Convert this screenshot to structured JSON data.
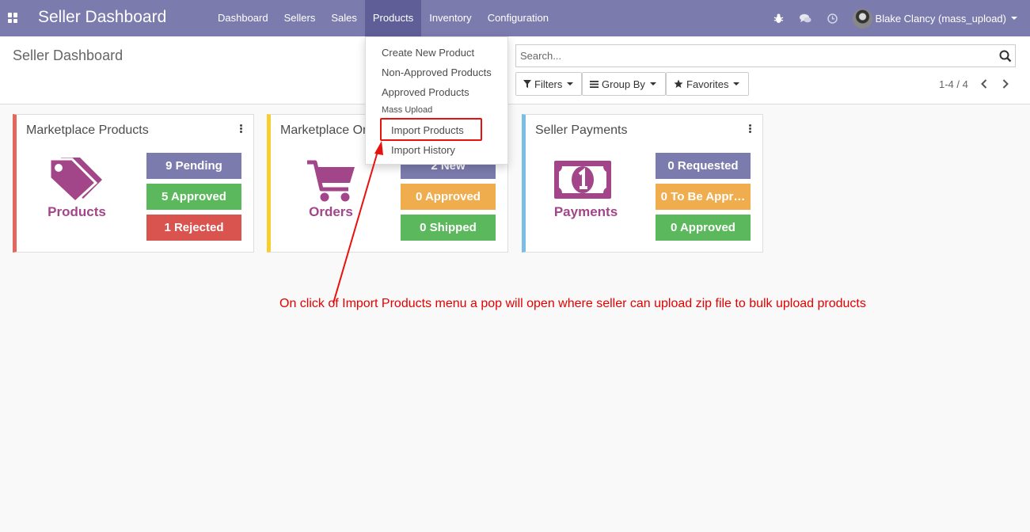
{
  "navbar": {
    "brand": "Seller Dashboard",
    "menu": [
      "Dashboard",
      "Sellers",
      "Sales",
      "Products",
      "Inventory",
      "Configuration"
    ],
    "active_menu": "Products",
    "user_name": "Blake Clancy (mass_upload)",
    "bg_color": "#7c7bad"
  },
  "control_panel": {
    "breadcrumb": "Seller Dashboard",
    "search_placeholder": "Search...",
    "filters_label": "Filters",
    "group_by_label": "Group By",
    "favorites_label": "Favorites",
    "pager": "1-4 / 4"
  },
  "dropdown": {
    "items": [
      "Create New Product",
      "Non-Approved Products",
      "Approved Products"
    ],
    "section_header": "Mass Upload",
    "sub_items": [
      "Import Products",
      "Import History"
    ],
    "highlighted": "Import Products"
  },
  "cards": [
    {
      "title": "Marketplace Products",
      "label": "Products",
      "accent": "#e4675c",
      "icon": "tags-icon",
      "stats": [
        {
          "text": "9 Pending",
          "color": "#7c7bad"
        },
        {
          "text": "5 Approved",
          "color": "#5cb85c"
        },
        {
          "text": "1 Rejected",
          "color": "#d9534f"
        }
      ]
    },
    {
      "title": "Marketplace Orders",
      "title_visible": "Marketplace Or",
      "label": "Orders",
      "accent": "#f8ce2e",
      "icon": "shopping-cart-icon",
      "stats": [
        {
          "text": "2 New",
          "color": "#7c7bad"
        },
        {
          "text": "0 Approved",
          "color": "#f0ad4e"
        },
        {
          "text": "0 Shipped",
          "color": "#5cb85c"
        }
      ]
    },
    {
      "title": "Seller Payments",
      "label": "Payments",
      "accent": "#7cbde6",
      "icon": "money-bill-icon",
      "stats": [
        {
          "text": "0 Requested",
          "color": "#7c7bad"
        },
        {
          "text": "0 To Be Appr…",
          "color": "#f0ad4e"
        },
        {
          "text": "0 Approved",
          "color": "#5cb85c"
        }
      ]
    }
  ],
  "annotation": "On click of Import Products menu a pop will open where seller can upload zip file to bulk upload products"
}
